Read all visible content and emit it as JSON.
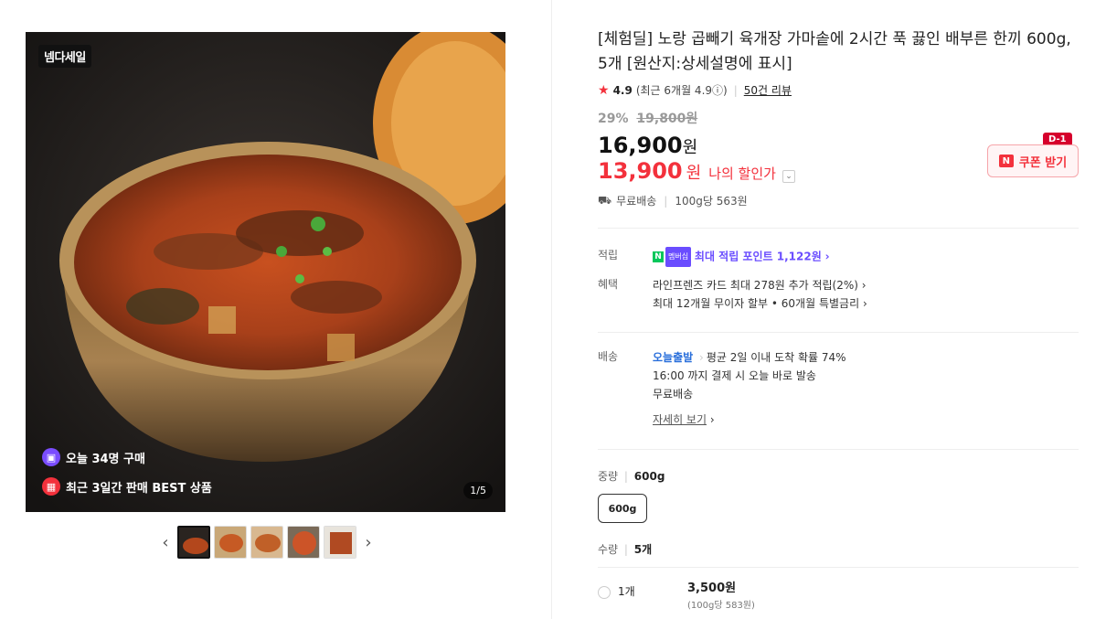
{
  "gallery": {
    "badge": "넴다세일",
    "today_buy": "오늘 34명 구매",
    "best_text": "최근 3일간 판매 BEST 상품",
    "page_indicator": "1/5"
  },
  "product": {
    "title": "[체험딜] 노랑 곱빼기 육개장 가마솥에 2시간 푹 끓인 배부른 한끼 600g, 5개 [원산지:상세설명에 표시]",
    "rating": "4.9",
    "rating_recent": "(최근 6개월 4.9ⓘ)",
    "review_link": "50건 리뷰",
    "discount_pct": "29%",
    "original_price": "19,800원",
    "price": "16,900",
    "price_unit": "원",
    "my_price": "13,900",
    "my_price_unit": "원",
    "my_price_label": "나의 할인가",
    "shipping": "무료배송",
    "unit_price": "100g당 563원"
  },
  "coupon": {
    "label": "쿠폰 받기",
    "d_badge": "D-1"
  },
  "benefits": {
    "point_key": "적립",
    "point_badge": "멤버십",
    "point_text": "최대 적립 포인트 1,122원",
    "benefit_key": "혜택",
    "benefit_line1": "라인프렌즈 카드 최대 278원 추가 적립(2%)",
    "benefit_line2": "최대 12개월 무이자 할부 • 60개월 특별금리"
  },
  "delivery": {
    "key": "배송",
    "today": "오늘출발",
    "avg": "평균 2일 이내 도착 확률 74%",
    "cutoff": "16:00 까지 결제 시 오늘 바로 발송",
    "free": "무료배송",
    "detail_link": "자세히 보기"
  },
  "options": {
    "weight_key": "중량",
    "weight_value": "600g",
    "weight_option": "600g",
    "qty_key": "수량",
    "qty_value": "5개",
    "row1_label": "1개",
    "row1_price": "3,500원",
    "row1_unit": "(100g당 583원)"
  },
  "colors": {
    "accent": "#f3313c",
    "point": "#6a4dff",
    "delivery": "#2a6fdb"
  }
}
